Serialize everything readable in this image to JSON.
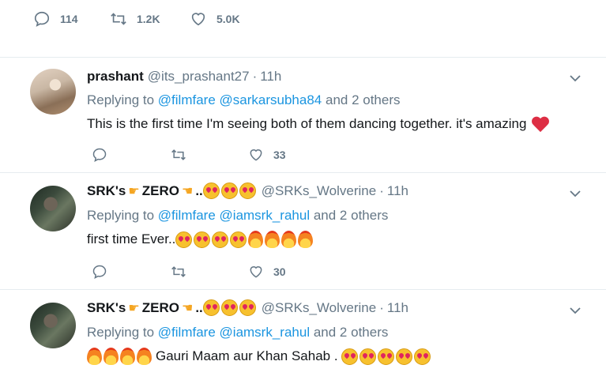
{
  "top_actions": {
    "replies": "114",
    "retweets": "1.2K",
    "likes": "5.0K"
  },
  "tweets": [
    {
      "name": "prashant",
      "handle": "@its_prashant27",
      "time": "11h",
      "replying_prefix": "Replying to",
      "mention1": "@filmfare",
      "mention2": "@sarkarsubha84",
      "others": "and 2 others",
      "text": "This is the first time I'm seeing both of them dancing together. it's amazing",
      "likes": "33"
    },
    {
      "name": "SRK's",
      "name_mid": "ZERO",
      "name_end": "..",
      "handle": "@SRKs_Wolverine",
      "time": "11h",
      "replying_prefix": "Replying to",
      "mention1": "@filmfare",
      "mention2": "@iamsrk_rahul",
      "others": "and 2 others",
      "text": "first time Ever..",
      "likes": "30"
    },
    {
      "name": "SRK's",
      "name_mid": "ZERO",
      "name_end": "..",
      "handle": "@SRKs_Wolverine",
      "time": "11h",
      "replying_prefix": "Replying to",
      "mention1": "@filmfare",
      "mention2": "@iamsrk_rahul",
      "others": "and 2 others",
      "text": "Gauri Maam aur Khan Sahab ."
    }
  ],
  "colors": {
    "accent": "#1b95e0",
    "muted": "#657786",
    "text": "#14171a"
  },
  "icons": [
    "reply-icon",
    "retweet-icon",
    "like-icon",
    "chevron-down-icon",
    "heart-eyes-emoji",
    "fire-emoji",
    "pointing-hand-emoji",
    "red-heart-emoji"
  ]
}
